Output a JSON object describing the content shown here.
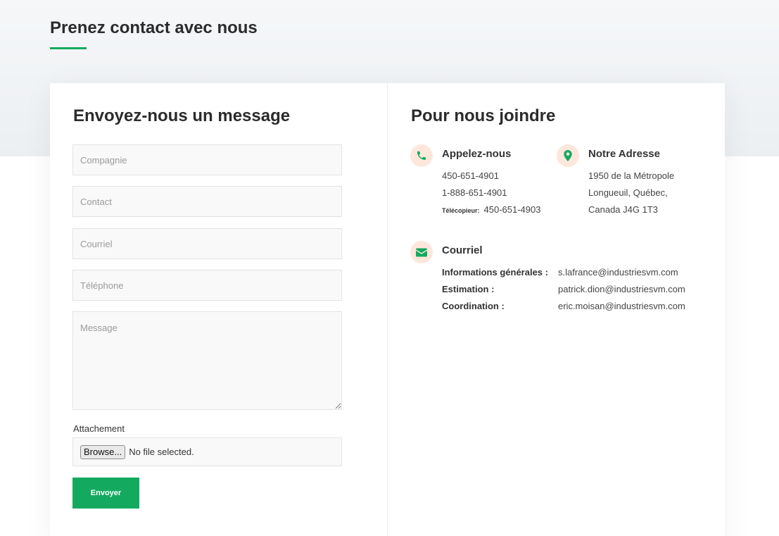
{
  "page_title": "Prenez contact avec nous",
  "colors": {
    "accent": "#13aa60",
    "icon_bg": "#fde7dc",
    "band": "#eef1f4"
  },
  "form": {
    "heading": "Envoyez-nous un message",
    "fields": {
      "company_placeholder": "Compagnie",
      "contact_placeholder": "Contact",
      "email_placeholder": "Courriel",
      "phone_placeholder": "Téléphone",
      "message_placeholder": "Message"
    },
    "attachment_label": "Attachement",
    "browse_label": "Browse...",
    "no_file_text": "No file selected.",
    "submit_label": "Envoyer"
  },
  "contact_info": {
    "heading": "Pour nous joindre",
    "phone": {
      "icon": "phone-icon",
      "title": "Appelez-nous",
      "line1": "450-651-4901",
      "line2": "1-888-651-4901",
      "fax_label": "Télécopieur:",
      "fax_value": "450-651-4903"
    },
    "address": {
      "icon": "map-pin-icon",
      "title": "Notre Adresse",
      "line1": "1950 de la Métropole",
      "line2": "Longueuil, Québec,",
      "line3": "Canada J4G 1T3"
    },
    "email": {
      "icon": "envelope-icon",
      "title": "Courriel",
      "rows": [
        {
          "label": "Informations générales :",
          "value": "s.lafrance@industriesvm.com"
        },
        {
          "label": "Estimation :",
          "value": "patrick.dion@industriesvm.com"
        },
        {
          "label": "Coordination :",
          "value": "eric.moisan@industriesvm.com"
        }
      ]
    }
  }
}
